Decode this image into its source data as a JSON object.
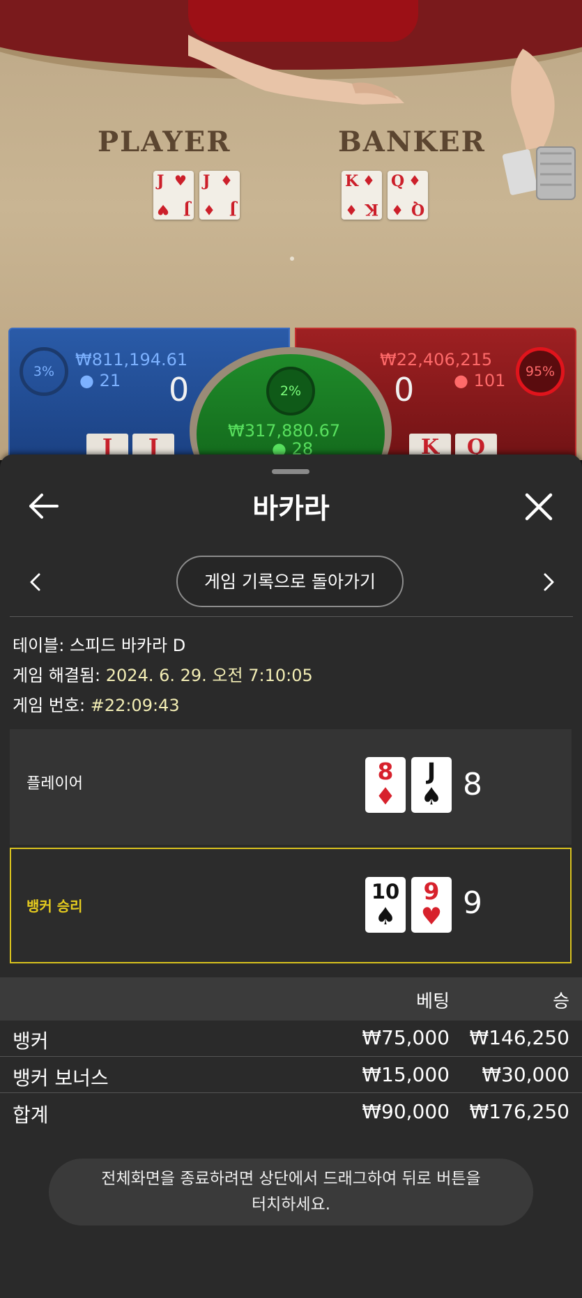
{
  "colors": {
    "player_blue": "#2a5ba8",
    "banker_red": "#9e2022",
    "tie_green": "#1f8b2a",
    "winner_outline": "#d9c21e",
    "sheet_bg": "#2a2a2a"
  },
  "video": {
    "player_word": "PLAYER",
    "banker_word": "BANKER",
    "player_cards": [
      {
        "rank": "J",
        "suit": "♥"
      },
      {
        "rank": "J",
        "suit": "♦"
      }
    ],
    "banker_cards": [
      {
        "rank": "K",
        "suit": "♦"
      },
      {
        "rank": "Q",
        "suit": "♦"
      }
    ]
  },
  "bet_panels": {
    "player": {
      "percent": "3%",
      "amount": "₩811,194.61",
      "players": "21",
      "score": "0",
      "cards": [
        "J",
        "J"
      ]
    },
    "tie": {
      "percent": "2%",
      "amount": "₩317,880.67",
      "players": "28"
    },
    "banker": {
      "percent": "95%",
      "amount": "₩22,406,215",
      "players": "101",
      "score": "0",
      "cards": [
        "K",
        "Q"
      ]
    }
  },
  "sheet": {
    "title": "바카라",
    "back_icon": "arrow-left-icon",
    "close_icon": "close-icon",
    "history_button": "게임 기록으로 돌아가기",
    "info": {
      "table_label": "테이블:",
      "table_value": "스피드 바카라 D",
      "resolved_label": "게임 해결됨:",
      "resolved_value": "2024. 6. 29. 오전 7:10:05",
      "game_no_label": "게임 번호:",
      "game_no_value": "#22:09:43"
    },
    "player_row": {
      "label": "플레이어",
      "cards": [
        {
          "rank": "8",
          "suit": "♦",
          "red": true
        },
        {
          "rank": "J",
          "suit": "♠",
          "red": false
        }
      ],
      "total": "8"
    },
    "banker_row": {
      "label": "뱅커 승리",
      "cards": [
        {
          "rank": "10",
          "suit": "♠",
          "red": false
        },
        {
          "rank": "9",
          "suit": "♥",
          "red": true
        }
      ],
      "total": "9"
    },
    "bets_header": {
      "bet": "베팅",
      "win": "승"
    },
    "bets": [
      {
        "label": "뱅커",
        "bet": "₩75,000",
        "win": "₩146,250"
      },
      {
        "label": "뱅커 보너스",
        "bet": "₩15,000",
        "win": "₩30,000"
      }
    ],
    "total": {
      "label": "합계",
      "bet": "₩90,000",
      "win": "₩176,250"
    }
  },
  "toast": {
    "line1": "전체화면을 종료하려면 상단에서 드래그하여 뒤로 버튼을",
    "line2": "터치하세요."
  }
}
